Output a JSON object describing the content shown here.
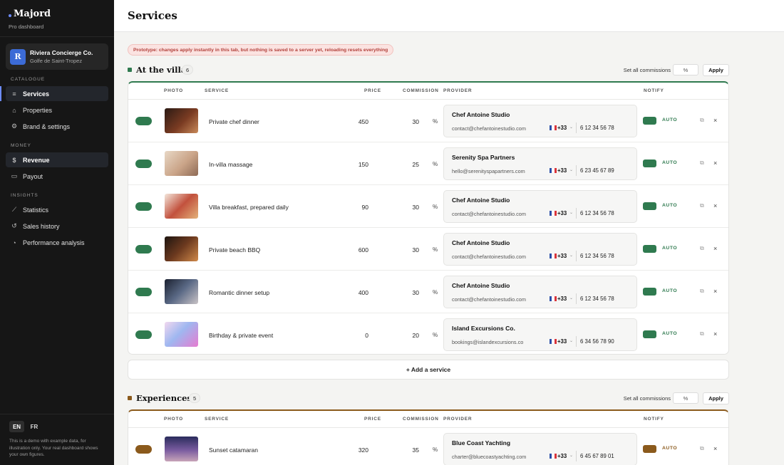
{
  "brand": {
    "name": "Majord",
    "subtitle": "Pro dashboard"
  },
  "org": {
    "initial": "R",
    "name": "Riviera Concierge Co.",
    "location": "Golfe de Saint-Tropez"
  },
  "nav": {
    "catalogue_label": "CATALOGUE",
    "money_label": "MONEY",
    "insights_label": "INSIGHTS",
    "items": [
      {
        "label": "Services",
        "icon": "list-icon",
        "active": true
      },
      {
        "label": "Properties",
        "icon": "home-icon",
        "active": false
      },
      {
        "label": "Brand & settings",
        "icon": "gear-icon",
        "active": false
      },
      {
        "label": "Revenue",
        "icon": "dollar-icon",
        "active": true
      },
      {
        "label": "Payout",
        "icon": "card-icon",
        "active": false
      },
      {
        "label": "Statistics",
        "icon": "chart-line-icon",
        "active": false
      },
      {
        "label": "Sales history",
        "icon": "history-icon",
        "active": false
      },
      {
        "label": "Performance analysis",
        "icon": "gauge-icon",
        "active": false
      }
    ]
  },
  "footer": {
    "lang_en": "EN",
    "lang_fr": "FR",
    "note": "This is a demo with example data, for illustration only. Your real dashboard shows your own figures."
  },
  "page": {
    "title": "Services",
    "prototype_notice": "Prototype: changes apply instantly in this tab, but nothing is saved to a server yet, reloading resets everything",
    "add_service": "+ Add a service"
  },
  "columns": {
    "photo": "PHOTO",
    "service": "SERVICE",
    "price": "PRICE",
    "commission": "COMMISSION",
    "provider": "PROVIDER",
    "notify": "NOTIFY"
  },
  "controls": {
    "set_all": "Set all commissions",
    "pct_placeholder": "%",
    "apply": "Apply",
    "pct": "%",
    "auto": "AUTO",
    "dial_code": "+33"
  },
  "colors": {
    "villa_accent": "#2f7a4f",
    "experiences_accent": "#8b5a1c"
  },
  "sections": [
    {
      "title": "At the villa",
      "count": "6",
      "rows": [
        {
          "service": "Private chef dinner",
          "price": "450",
          "commission": "30",
          "provider": "Chef Antoine Studio",
          "email": "contact@chefantoinestudio.com",
          "phone": "6 12 34 56 78"
        },
        {
          "service": "In-villa massage",
          "price": "150",
          "commission": "25",
          "provider": "Serenity Spa Partners",
          "email": "hello@serenityspapartners.com",
          "phone": "6 23 45 67 89"
        },
        {
          "service": "Villa breakfast, prepared daily",
          "price": "90",
          "commission": "30",
          "provider": "Chef Antoine Studio",
          "email": "contact@chefantoinestudio.com",
          "phone": "6 12 34 56 78"
        },
        {
          "service": "Private beach BBQ",
          "price": "600",
          "commission": "30",
          "provider": "Chef Antoine Studio",
          "email": "contact@chefantoinestudio.com",
          "phone": "6 12 34 56 78"
        },
        {
          "service": "Romantic dinner setup",
          "price": "400",
          "commission": "30",
          "provider": "Chef Antoine Studio",
          "email": "contact@chefantoinestudio.com",
          "phone": "6 12 34 56 78"
        },
        {
          "service": "Birthday & private event",
          "price": "0",
          "commission": "20",
          "provider": "Island Excursions Co.",
          "email": "bookings@islandexcursions.co",
          "phone": "6 34 56 78 90"
        }
      ]
    },
    {
      "title": "Experiences",
      "count": "5",
      "rows": [
        {
          "service": "Sunset catamaran",
          "price": "320",
          "commission": "35",
          "provider": "Blue Coast Yachting",
          "email": "charter@bluecoastyachting.com",
          "phone": "6 45 67 89 01"
        }
      ]
    }
  ]
}
